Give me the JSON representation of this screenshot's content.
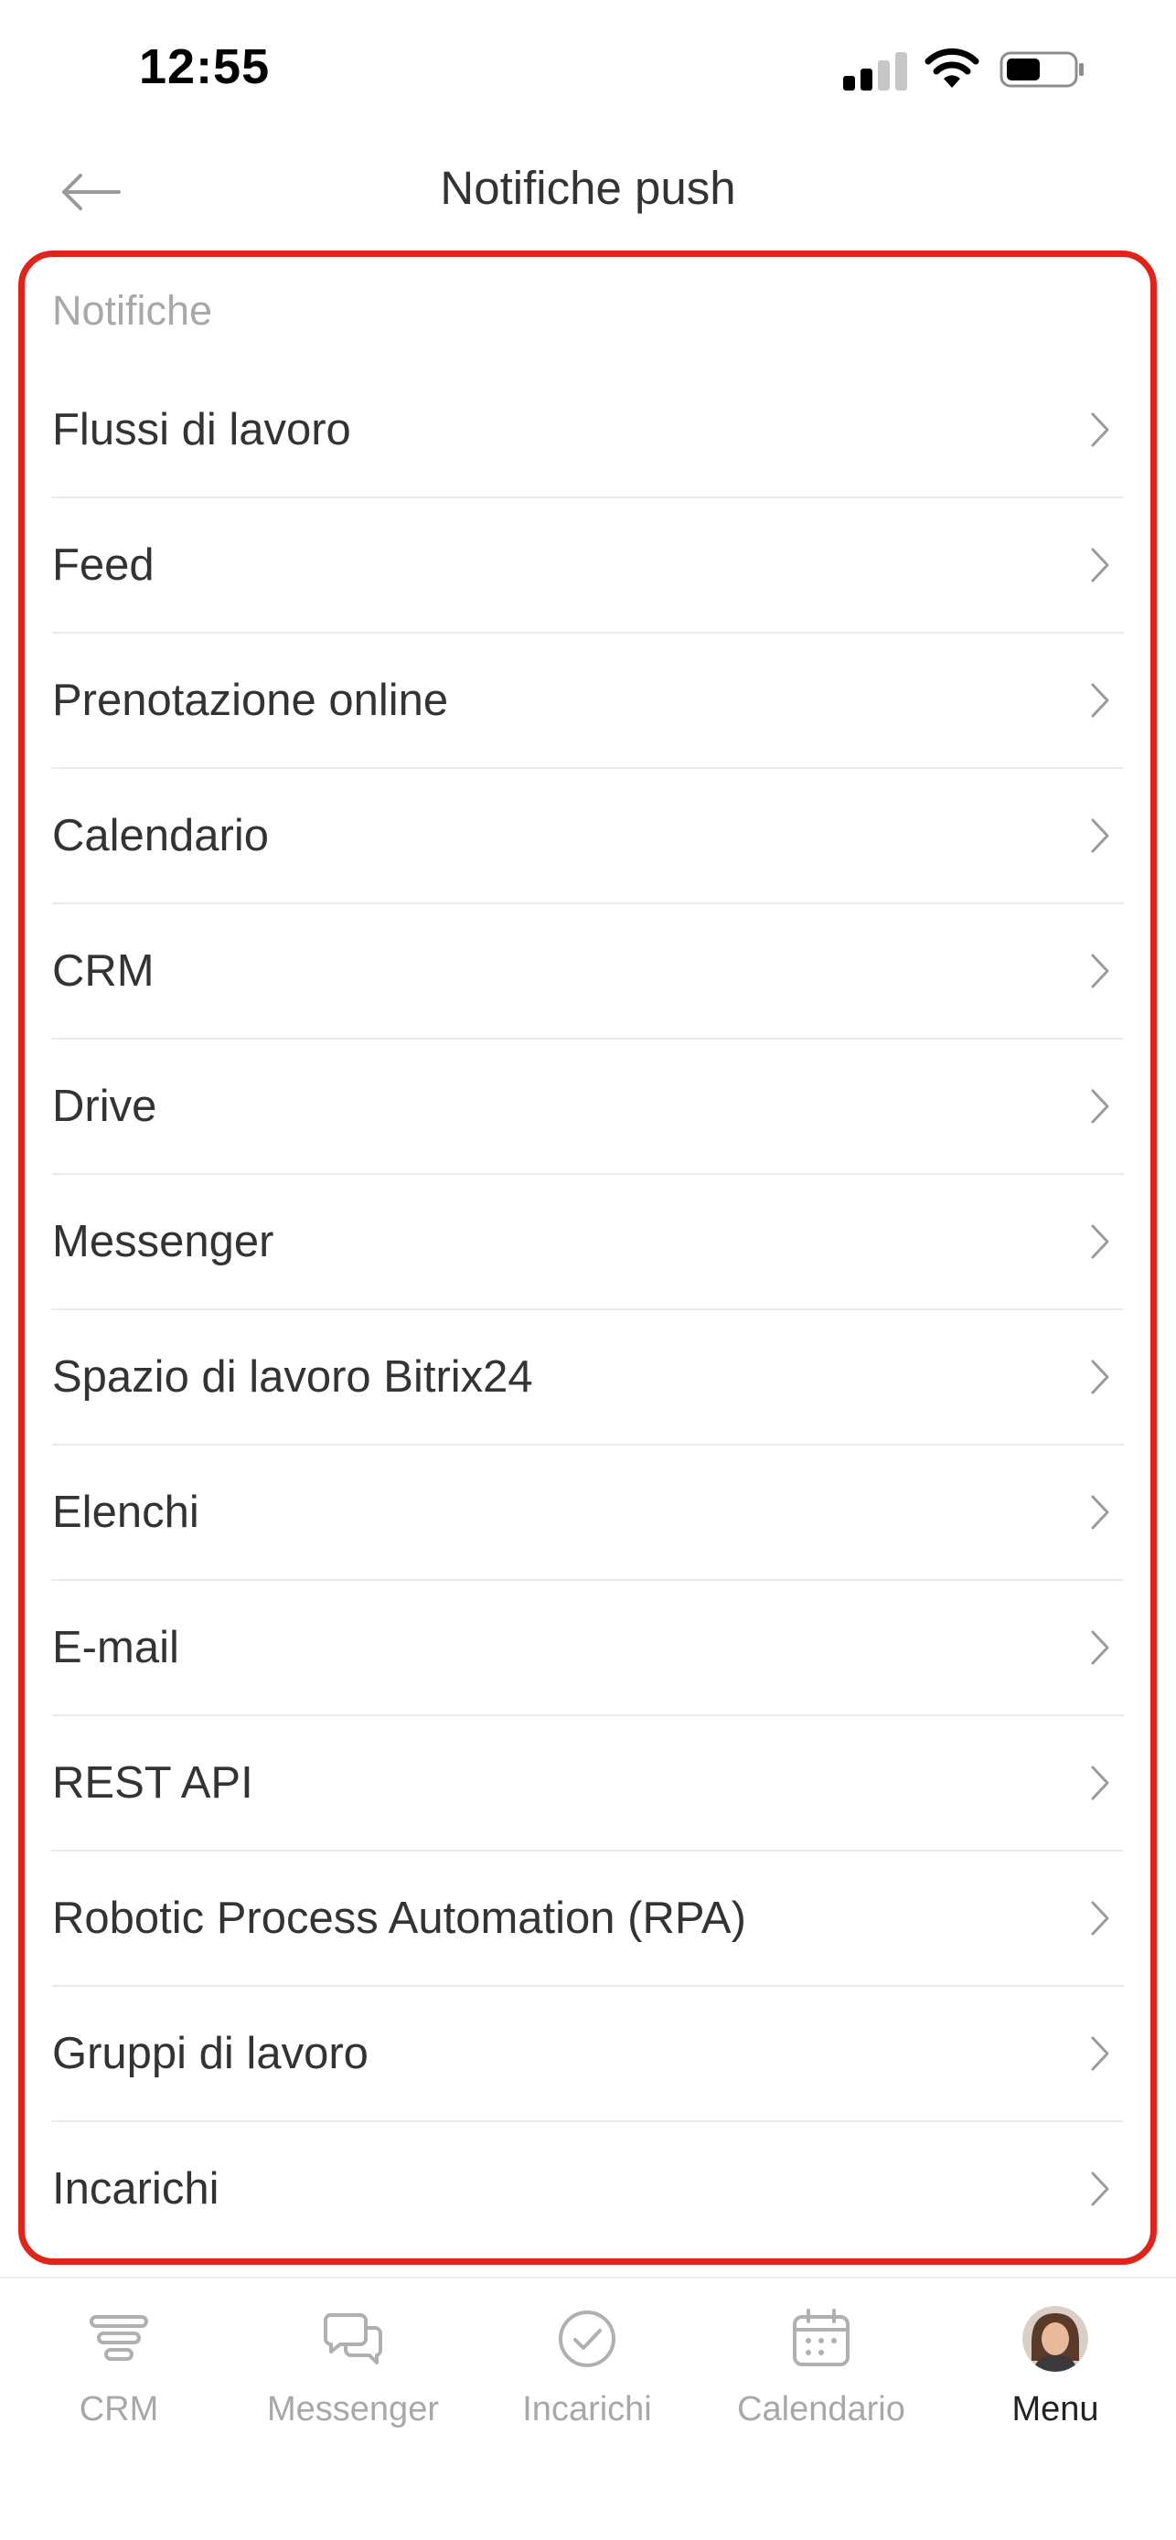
{
  "status_bar": {
    "time": "12:55"
  },
  "header": {
    "title": "Notifiche push",
    "back_icon": "arrow-left-icon"
  },
  "section": {
    "title": "Notifiche",
    "items": [
      {
        "label": "Flussi di lavoro"
      },
      {
        "label": "Feed"
      },
      {
        "label": "Prenotazione online"
      },
      {
        "label": "Calendario"
      },
      {
        "label": "CRM"
      },
      {
        "label": "Drive"
      },
      {
        "label": "Messenger"
      },
      {
        "label": "Spazio di lavoro Bitrix24"
      },
      {
        "label": "Elenchi"
      },
      {
        "label": "E-mail"
      },
      {
        "label": "REST API"
      },
      {
        "label": "Robotic Process Automation (RPA)"
      },
      {
        "label": "Gruppi di lavoro"
      },
      {
        "label": "Incarichi"
      }
    ]
  },
  "tab_bar": {
    "tabs": [
      {
        "label": "CRM",
        "icon": "crm-funnel-icon",
        "active": false
      },
      {
        "label": "Messenger",
        "icon": "chat-bubbles-icon",
        "active": false
      },
      {
        "label": "Incarichi",
        "icon": "check-circle-icon",
        "active": false
      },
      {
        "label": "Calendario",
        "icon": "calendar-icon",
        "active": false
      },
      {
        "label": "Menu",
        "icon": "avatar",
        "active": true
      }
    ]
  },
  "colors": {
    "highlight": "#e0231b",
    "text": "#333333",
    "muted": "#a8a8a8",
    "divider": "#ebebeb"
  }
}
